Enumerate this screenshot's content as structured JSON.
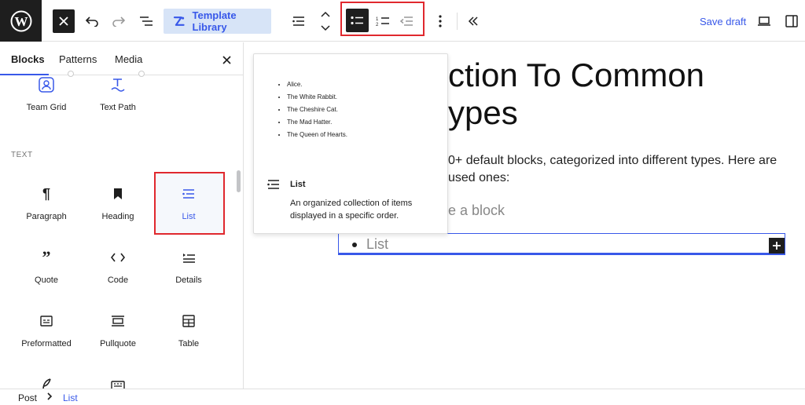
{
  "toolbar": {
    "template_library_label": "Template Library",
    "save_draft_label": "Save draft"
  },
  "sidebar": {
    "tabs": [
      {
        "label": "Blocks"
      },
      {
        "label": "Patterns"
      },
      {
        "label": "Media"
      }
    ],
    "section_title": "TEXT",
    "top_items": [
      {
        "label": "Team Grid",
        "icon": "team-grid-icon"
      },
      {
        "label": "Text Path",
        "icon": "text-path-icon"
      }
    ],
    "items": [
      {
        "label": "Paragraph",
        "icon": "paragraph-icon"
      },
      {
        "label": "Heading",
        "icon": "bookmark-icon"
      },
      {
        "label": "List",
        "icon": "list-icon",
        "selected": true
      },
      {
        "label": "Quote",
        "icon": "quote-icon"
      },
      {
        "label": "Code",
        "icon": "code-icon"
      },
      {
        "label": "Details",
        "icon": "details-icon"
      },
      {
        "label": "Preformatted",
        "icon": "preformatted-icon"
      },
      {
        "label": "Pullquote",
        "icon": "pullquote-icon"
      },
      {
        "label": "Table",
        "icon": "table-icon"
      }
    ]
  },
  "preview": {
    "sample_items": [
      "Alice.",
      "The White Rabbit.",
      "The Cheshire Cat.",
      "The Mad Hatter.",
      "The Queen of Hearts."
    ],
    "title": "List",
    "description": "An organized collection of items displayed in a specific order."
  },
  "editor": {
    "heading_line1": "ction To Common",
    "heading_line2": "ypes",
    "para_line1": "0+ default blocks, categorized into different types. Here are",
    "para_line2": "used ones:",
    "placeholder_fragment": "e a block",
    "list_placeholder": "List"
  },
  "footer": {
    "crumb_root": "Post",
    "crumb_current": "List"
  },
  "colors": {
    "accent": "#3858e9",
    "highlight": "#e0282e",
    "dark": "#1e1e1e"
  }
}
